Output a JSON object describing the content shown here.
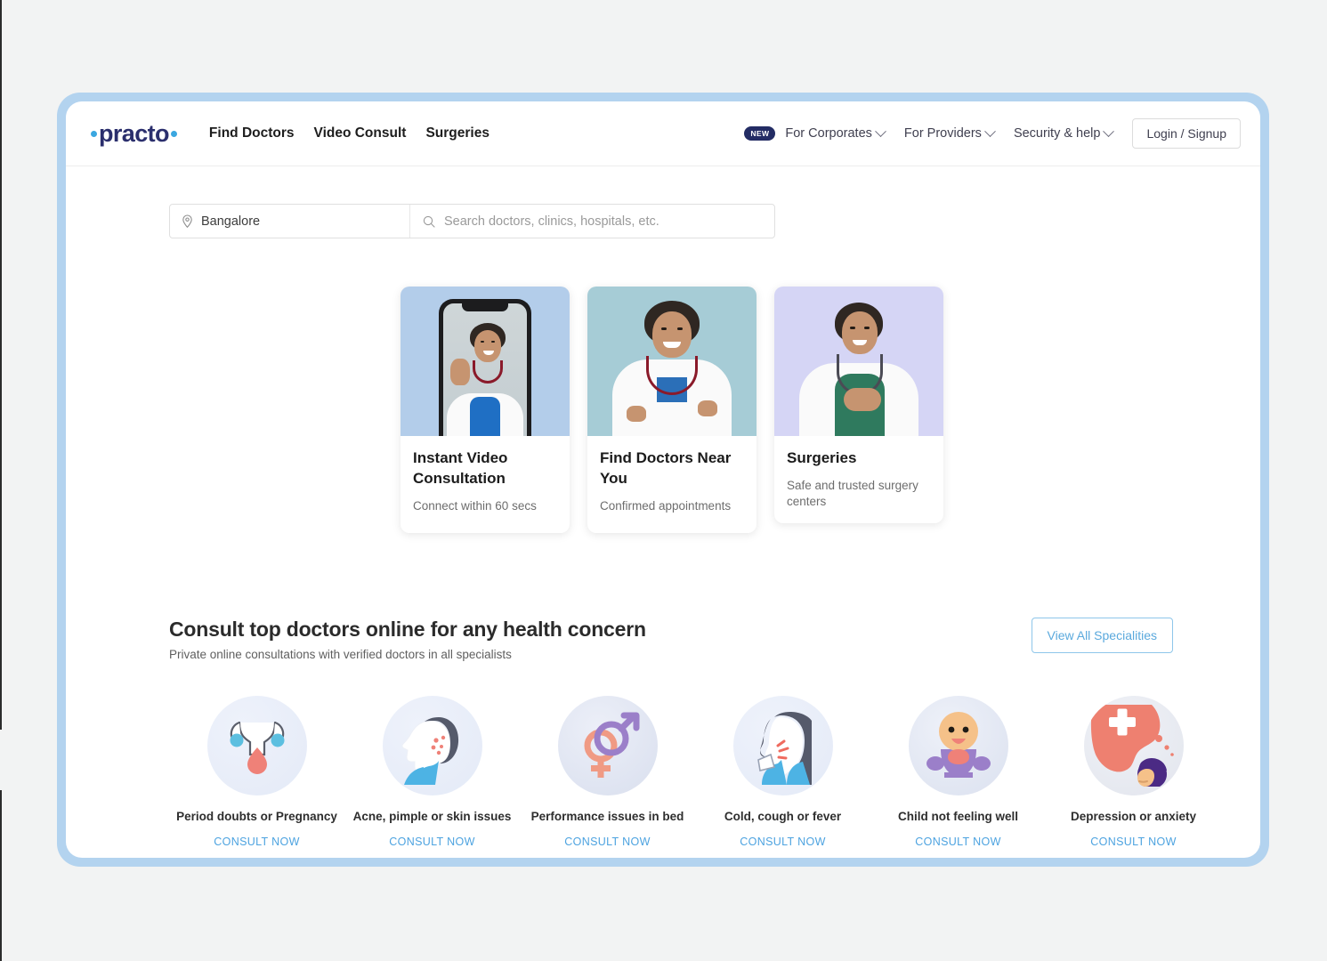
{
  "brand": {
    "name": "practo",
    "logo_color": "#2b2f6d",
    "dot_color": "#3ba7e0"
  },
  "header": {
    "nav": [
      {
        "label": "Find Doctors"
      },
      {
        "label": "Video Consult"
      },
      {
        "label": "Surgeries"
      }
    ],
    "right": [
      {
        "label": "For Corporates",
        "badge": "NEW",
        "caret": true
      },
      {
        "label": "For Providers",
        "caret": true
      },
      {
        "label": "Security & help",
        "caret": true
      }
    ],
    "login_label": "Login / Signup"
  },
  "search": {
    "location_icon": "location-pin-icon",
    "location_value": "Bangalore",
    "search_icon": "search-icon",
    "placeholder": "Search doctors, clinics, hospitals, etc."
  },
  "hero_cards": [
    {
      "title": "Instant Video Consultation",
      "subtitle": "Connect within 60 secs",
      "art": "doctor-waving-on-phone",
      "bg": "#b3cdea"
    },
    {
      "title": "Find Doctors Near You",
      "subtitle": "Confirmed appointments",
      "art": "female-doctor-arms-crossed",
      "bg": "#a6ccd6"
    },
    {
      "title": "Surgeries",
      "subtitle": "Safe and trusted surgery centers",
      "art": "female-doctor-hand-on-chest",
      "bg": "#d5d5f5"
    }
  ],
  "consult_section": {
    "title": "Consult top doctors online for any health concern",
    "subtitle": "Private online consultations with verified doctors in all specialists",
    "view_all_label": "View All Specialities",
    "accent_color": "#4da3e0"
  },
  "specialities": [
    {
      "label": "Period doubts or Pregnancy",
      "cta": "CONSULT NOW",
      "icon": "uterus-icon"
    },
    {
      "label": "Acne, pimple or skin issues",
      "cta": "CONSULT NOW",
      "icon": "face-acne-icon"
    },
    {
      "label": "Performance issues in bed",
      "cta": "CONSULT NOW",
      "icon": "gender-symbols-icon"
    },
    {
      "label": "Cold, cough or fever",
      "cta": "CONSULT NOW",
      "icon": "coughing-person-icon"
    },
    {
      "label": "Child not feeling well",
      "cta": "CONSULT NOW",
      "icon": "baby-icon"
    },
    {
      "label": "Depression or anxiety",
      "cta": "CONSULT NOW",
      "icon": "mental-health-cross-icon"
    }
  ]
}
